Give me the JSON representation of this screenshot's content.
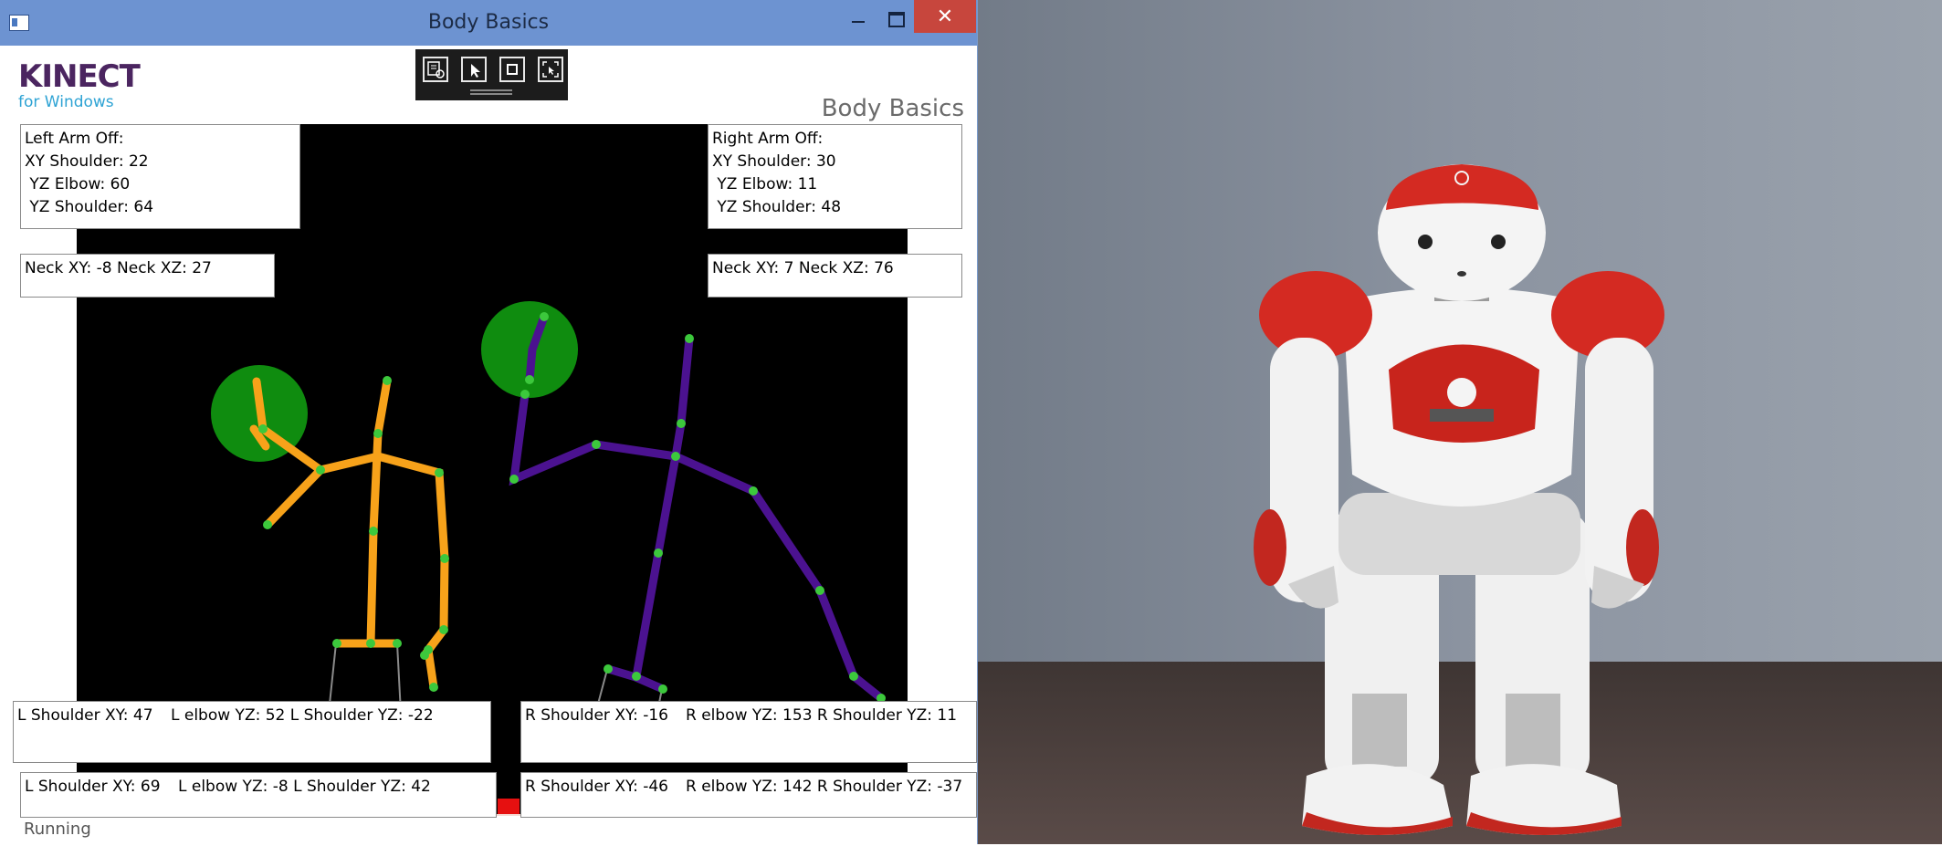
{
  "window": {
    "title": "Body Basics"
  },
  "header": {
    "logo_main": "KINECT",
    "logo_sub": "for Windows",
    "title": "Body Basics"
  },
  "left_arm": {
    "lines": [
      "Left Arm Off:",
      "XY Shoulder: 22",
      " YZ Elbow: 60",
      " YZ Shoulder: 64"
    ]
  },
  "right_arm": {
    "lines": [
      "Right Arm Off:",
      "XY Shoulder: 30",
      " YZ Elbow: 11",
      " YZ Shoulder: 48"
    ]
  },
  "neck_left": "Neck XY: -8 Neck XZ: 27",
  "neck_right": "Neck XY: 7 Neck XZ: 76",
  "left_row1": {
    "shoulder_xy": "L Shoulder XY: 47",
    "elbow_shoulder_yz": "L elbow YZ: 52 L Shoulder YZ: -22"
  },
  "right_row1": {
    "shoulder_xy": "R Shoulder XY: -16",
    "elbow_shoulder_yz": "R elbow YZ: 153 R Shoulder YZ: 11"
  },
  "left_row2": {
    "shoulder_xy": "L Shoulder XY: 69",
    "elbow_shoulder_yz": "L elbow YZ: -8 L Shoulder YZ: 42"
  },
  "right_row2": {
    "shoulder_xy": "R Shoulder XY: -46",
    "elbow_shoulder_yz": "R elbow YZ: 142 R Shoulder YZ: -37"
  },
  "status": "Running",
  "colors": {
    "body1": "#f7a21a",
    "body2": "#4b1290",
    "joint": "#3cc83c",
    "hand": "#0f8c0f",
    "close": "#c7463d",
    "titlebar": "#6d93d1"
  },
  "icons": [
    "app-window-icon",
    "minimize-icon",
    "maximize-icon",
    "close-icon",
    "settings-select-icon",
    "cursor-select-icon",
    "frame-icon",
    "screenshot-icon"
  ],
  "photo": {
    "subject": "white and red humanoid robot standing in front of a gray fabric wall"
  }
}
